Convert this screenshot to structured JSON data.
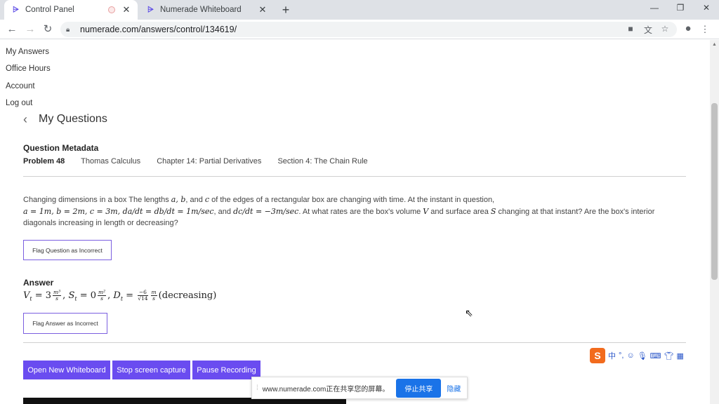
{
  "browser": {
    "tabs": [
      {
        "title": "Control Panel",
        "favicon": "numerade-logo-icon",
        "active": true
      },
      {
        "title": "Numerade Whiteboard",
        "favicon": "numerade-logo-icon",
        "active": false
      }
    ],
    "url": "numerade.com/answers/control/134619/"
  },
  "sidebar": {
    "items": [
      {
        "label": "My Answers"
      },
      {
        "label": "Office Hours"
      },
      {
        "label": "Account"
      },
      {
        "label": "Log out"
      }
    ]
  },
  "page": {
    "title": "My Questions"
  },
  "metadata": {
    "heading": "Question Metadata",
    "problem": "Problem 48",
    "book": "Thomas Calculus",
    "chapter": "Chapter 14: Partial Derivatives",
    "section": "Section 4: The Chain Rule"
  },
  "question": {
    "t1": "Changing dimensions in a box The lengths ",
    "t2": ", and ",
    "t3": " of the edges of a rectangular box are changing with time. At the instant in question,",
    "t4": ", and ",
    "t5": ". At what rates are the box's volume ",
    "t6": " and surface area ",
    "t7": " changing at that instant? Are the box's interior diagonals increasing in length or decreasing?",
    "math_ab": "a, b",
    "math_c": "c",
    "math_vals": "a = 1m, b = 2m, c = 3m, da/dt = db/dt = 1m/sec",
    "math_dc": "dc/dt = −3m/sec",
    "math_V": "V",
    "math_S": "S",
    "flag_label": "Flag Question as Incorrect"
  },
  "answer": {
    "heading": "Answer",
    "vt": "V",
    "vt_sub": "t",
    "vt_eq": " = 3",
    "vt_num": "m³",
    "vt_den": "s",
    "st": "S",
    "st_sub": "t",
    "st_eq": " = 0",
    "st_num": "m²",
    "st_den": "s",
    "dt": "D",
    "dt_sub": "t",
    "dt_num": "−6",
    "dt_den": "√14",
    "dt_unit_num": "m",
    "dt_unit_den": "s",
    "note": "(decreasing)",
    "flag_label": "Flag Answer as Incorrect"
  },
  "actions": {
    "whiteboard": "Open New Whiteboard",
    "stop_capture": "Stop screen capture",
    "pause": "Pause Recording"
  },
  "share_banner": {
    "text": "www.numerade.com正在共享您的屏幕。",
    "stop": "停止共享",
    "hide": "隐藏"
  },
  "ime": {
    "logo": "S",
    "mode": "中"
  },
  "colors": {
    "accent": "#6a4cf0",
    "flag_border": "#7b5fe0",
    "share_blue": "#1a73e8"
  }
}
